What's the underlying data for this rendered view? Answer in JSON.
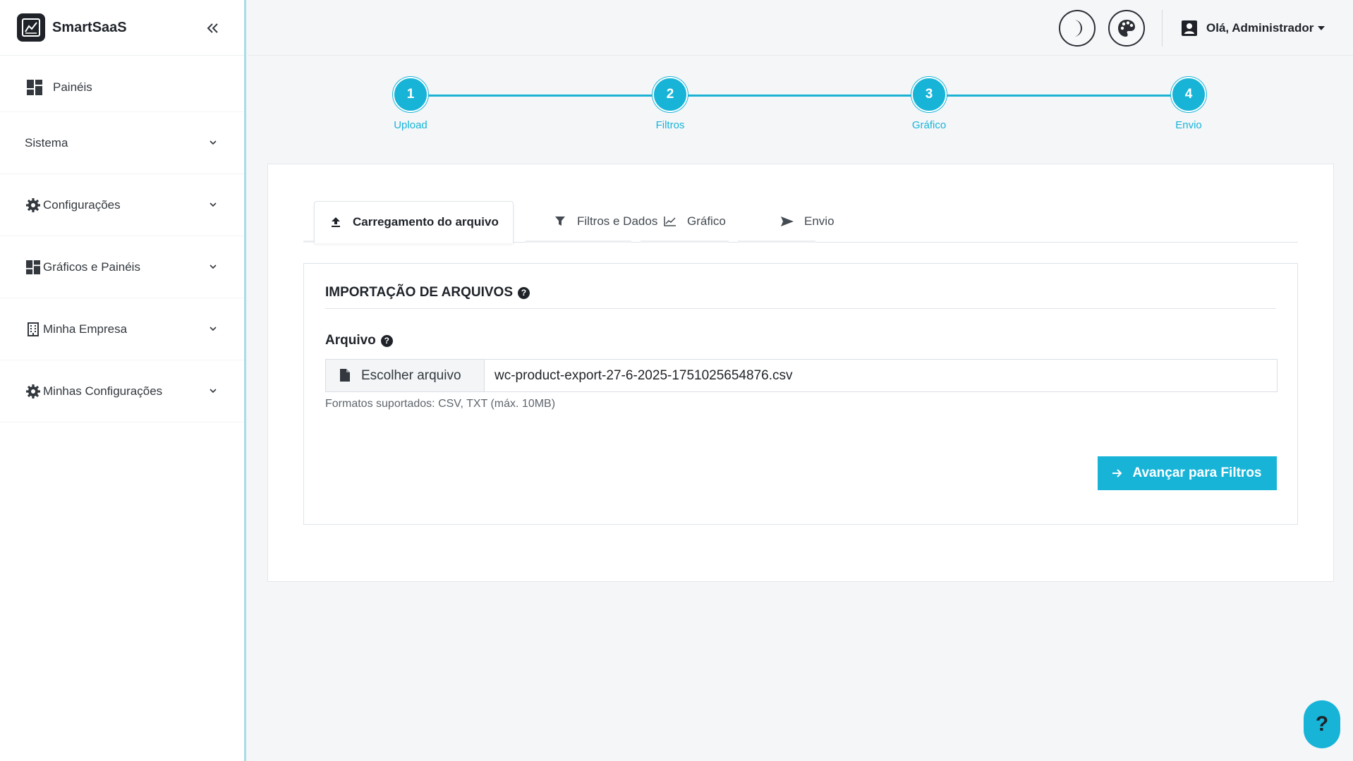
{
  "brand": {
    "name": "SmartSaaS"
  },
  "sidebar": {
    "items": [
      {
        "label": "Painéis",
        "icon": "dashboard-icon"
      },
      {
        "label": "Sistema",
        "icon": ""
      },
      {
        "label": "Configurações",
        "icon": "gear-icon"
      },
      {
        "label": "Gráficos e Painéis",
        "icon": "dashboard-icon"
      },
      {
        "label": "Minha Empresa",
        "icon": "building-icon"
      },
      {
        "label": "Minhas Configurações",
        "icon": "gear-icon"
      }
    ]
  },
  "topbar": {
    "theme_icon": "moon-icon",
    "palette_icon": "palette-icon",
    "user_greeting": "Olá, Administrador"
  },
  "stepper": {
    "steps": [
      {
        "number": "1",
        "label": "Upload"
      },
      {
        "number": "2",
        "label": "Filtros"
      },
      {
        "number": "3",
        "label": "Gráfico"
      },
      {
        "number": "4",
        "label": "Envio"
      }
    ]
  },
  "tabs": [
    {
      "label": "Carregamento do arquivo",
      "icon": "upload-icon",
      "active": true
    },
    {
      "label": "Filtros e Dados",
      "icon": "filter-icon",
      "active": false
    },
    {
      "label": "Gráfico",
      "icon": "line-chart-icon",
      "active": false
    },
    {
      "label": "Envio",
      "icon": "send-icon",
      "active": false
    }
  ],
  "panel": {
    "title": "IMPORTAÇÃO DE ARQUIVOS",
    "field_label": "Arquivo",
    "choose_file_label": "Escolher arquivo",
    "file_name": "wc-product-export-27-6-2025-1751025654876.csv",
    "hint": "Formatos suportados: CSV, TXT (máx. 10MB)",
    "next_button": "Avançar para Filtros"
  },
  "help": {
    "label": "?"
  },
  "colors": {
    "accent": "#17b4d8",
    "dark": "#1f2329"
  }
}
